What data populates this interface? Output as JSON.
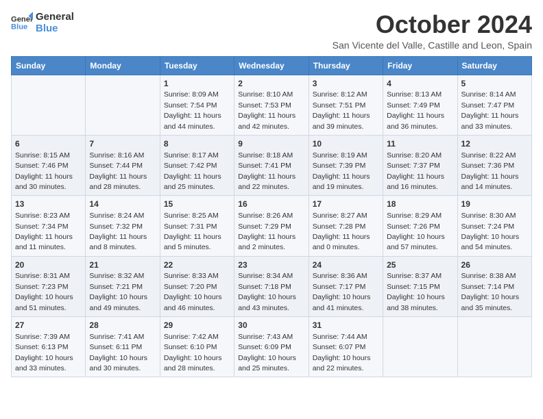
{
  "logo": {
    "line1": "General",
    "line2": "Blue"
  },
  "title": "October 2024",
  "subtitle": "San Vicente del Valle, Castille and Leon, Spain",
  "days_of_week": [
    "Sunday",
    "Monday",
    "Tuesday",
    "Wednesday",
    "Thursday",
    "Friday",
    "Saturday"
  ],
  "weeks": [
    [
      {
        "day": "",
        "info": ""
      },
      {
        "day": "",
        "info": ""
      },
      {
        "day": "1",
        "info": "Sunrise: 8:09 AM\nSunset: 7:54 PM\nDaylight: 11 hours and 44 minutes."
      },
      {
        "day": "2",
        "info": "Sunrise: 8:10 AM\nSunset: 7:53 PM\nDaylight: 11 hours and 42 minutes."
      },
      {
        "day": "3",
        "info": "Sunrise: 8:12 AM\nSunset: 7:51 PM\nDaylight: 11 hours and 39 minutes."
      },
      {
        "day": "4",
        "info": "Sunrise: 8:13 AM\nSunset: 7:49 PM\nDaylight: 11 hours and 36 minutes."
      },
      {
        "day": "5",
        "info": "Sunrise: 8:14 AM\nSunset: 7:47 PM\nDaylight: 11 hours and 33 minutes."
      }
    ],
    [
      {
        "day": "6",
        "info": "Sunrise: 8:15 AM\nSunset: 7:46 PM\nDaylight: 11 hours and 30 minutes."
      },
      {
        "day": "7",
        "info": "Sunrise: 8:16 AM\nSunset: 7:44 PM\nDaylight: 11 hours and 28 minutes."
      },
      {
        "day": "8",
        "info": "Sunrise: 8:17 AM\nSunset: 7:42 PM\nDaylight: 11 hours and 25 minutes."
      },
      {
        "day": "9",
        "info": "Sunrise: 8:18 AM\nSunset: 7:41 PM\nDaylight: 11 hours and 22 minutes."
      },
      {
        "day": "10",
        "info": "Sunrise: 8:19 AM\nSunset: 7:39 PM\nDaylight: 11 hours and 19 minutes."
      },
      {
        "day": "11",
        "info": "Sunrise: 8:20 AM\nSunset: 7:37 PM\nDaylight: 11 hours and 16 minutes."
      },
      {
        "day": "12",
        "info": "Sunrise: 8:22 AM\nSunset: 7:36 PM\nDaylight: 11 hours and 14 minutes."
      }
    ],
    [
      {
        "day": "13",
        "info": "Sunrise: 8:23 AM\nSunset: 7:34 PM\nDaylight: 11 hours and 11 minutes."
      },
      {
        "day": "14",
        "info": "Sunrise: 8:24 AM\nSunset: 7:32 PM\nDaylight: 11 hours and 8 minutes."
      },
      {
        "day": "15",
        "info": "Sunrise: 8:25 AM\nSunset: 7:31 PM\nDaylight: 11 hours and 5 minutes."
      },
      {
        "day": "16",
        "info": "Sunrise: 8:26 AM\nSunset: 7:29 PM\nDaylight: 11 hours and 2 minutes."
      },
      {
        "day": "17",
        "info": "Sunrise: 8:27 AM\nSunset: 7:28 PM\nDaylight: 11 hours and 0 minutes."
      },
      {
        "day": "18",
        "info": "Sunrise: 8:29 AM\nSunset: 7:26 PM\nDaylight: 10 hours and 57 minutes."
      },
      {
        "day": "19",
        "info": "Sunrise: 8:30 AM\nSunset: 7:24 PM\nDaylight: 10 hours and 54 minutes."
      }
    ],
    [
      {
        "day": "20",
        "info": "Sunrise: 8:31 AM\nSunset: 7:23 PM\nDaylight: 10 hours and 51 minutes."
      },
      {
        "day": "21",
        "info": "Sunrise: 8:32 AM\nSunset: 7:21 PM\nDaylight: 10 hours and 49 minutes."
      },
      {
        "day": "22",
        "info": "Sunrise: 8:33 AM\nSunset: 7:20 PM\nDaylight: 10 hours and 46 minutes."
      },
      {
        "day": "23",
        "info": "Sunrise: 8:34 AM\nSunset: 7:18 PM\nDaylight: 10 hours and 43 minutes."
      },
      {
        "day": "24",
        "info": "Sunrise: 8:36 AM\nSunset: 7:17 PM\nDaylight: 10 hours and 41 minutes."
      },
      {
        "day": "25",
        "info": "Sunrise: 8:37 AM\nSunset: 7:15 PM\nDaylight: 10 hours and 38 minutes."
      },
      {
        "day": "26",
        "info": "Sunrise: 8:38 AM\nSunset: 7:14 PM\nDaylight: 10 hours and 35 minutes."
      }
    ],
    [
      {
        "day": "27",
        "info": "Sunrise: 7:39 AM\nSunset: 6:13 PM\nDaylight: 10 hours and 33 minutes."
      },
      {
        "day": "28",
        "info": "Sunrise: 7:41 AM\nSunset: 6:11 PM\nDaylight: 10 hours and 30 minutes."
      },
      {
        "day": "29",
        "info": "Sunrise: 7:42 AM\nSunset: 6:10 PM\nDaylight: 10 hours and 28 minutes."
      },
      {
        "day": "30",
        "info": "Sunrise: 7:43 AM\nSunset: 6:09 PM\nDaylight: 10 hours and 25 minutes."
      },
      {
        "day": "31",
        "info": "Sunrise: 7:44 AM\nSunset: 6:07 PM\nDaylight: 10 hours and 22 minutes."
      },
      {
        "day": "",
        "info": ""
      },
      {
        "day": "",
        "info": ""
      }
    ]
  ]
}
